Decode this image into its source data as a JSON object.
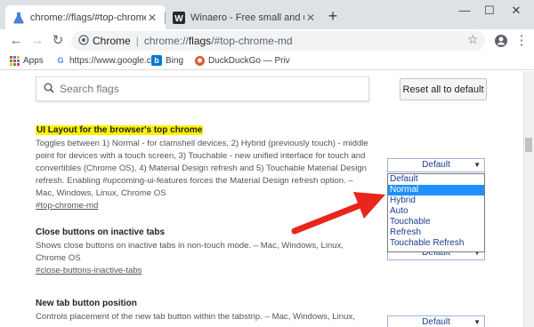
{
  "tabs": [
    {
      "title": "chrome://flags/#top-chrome-md",
      "active": true
    },
    {
      "title": "Winaero - Free small and useful s",
      "active": false
    }
  ],
  "toolbar": {
    "omnibox_origin": "Chrome",
    "omnibox_url_scheme": "chrome://",
    "omnibox_url_host": "flags",
    "omnibox_url_path": "/#top-chrome-md"
  },
  "bookmarks": [
    {
      "label": "Apps",
      "icon": "apps-grid-icon"
    },
    {
      "label": "https://www.google.c",
      "icon": "google-icon"
    },
    {
      "label": "Bing",
      "icon": "bing-icon"
    },
    {
      "label": "DuckDuckGo — Priv",
      "icon": "duckduckgo-icon"
    }
  ],
  "search": {
    "placeholder": "Search flags"
  },
  "reset_label": "Reset all to default",
  "flags": [
    {
      "title": "UI Layout for the browser's top chrome",
      "description": "Toggles between 1) Normal - for clamshell devices, 2) Hybrid (previously touch) - middle point for devices with a touch screen, 3) Touchable - new unified interface for touch and convertibles (Chrome OS), 4) Material Design refresh and 5) Touchable Material Design refresh. Enabling #upcoming-ui-features forces the Material Design refresh option. – Mac, Windows, Linux, Chrome OS",
      "link": "#top-chrome-md",
      "value": "Default"
    },
    {
      "title": "Close buttons on inactive tabs",
      "description": "Shows close buttons on inactive tabs in non-touch mode. – Mac, Windows, Linux, Chrome OS",
      "link": "#close-buttons-inactive-tabs",
      "value": "Default"
    },
    {
      "title": "New tab button position",
      "description": "Controls placement of the new tab button within the tabstrip. – Mac, Windows, Linux,",
      "link": "",
      "value": "Default"
    }
  ],
  "dropdown_options": [
    "Default",
    "Normal",
    "Hybrid",
    "Auto",
    "Touchable",
    "Refresh",
    "Touchable Refresh"
  ],
  "dropdown_selected_index": 1,
  "colors": {
    "highlight": "#fff200",
    "selected_option": "#1e90ff",
    "annotation_arrow": "#e8261c"
  }
}
